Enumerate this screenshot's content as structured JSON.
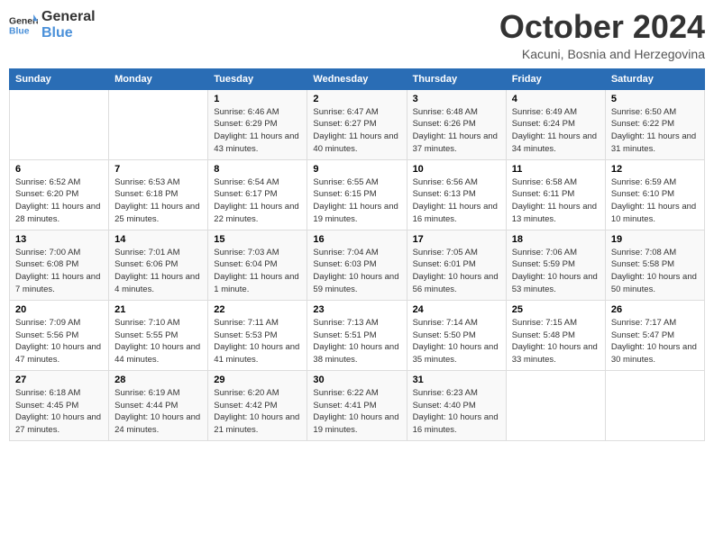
{
  "header": {
    "logo_general": "General",
    "logo_blue": "Blue",
    "month": "October 2024",
    "location": "Kacuni, Bosnia and Herzegovina"
  },
  "weekdays": [
    "Sunday",
    "Monday",
    "Tuesday",
    "Wednesday",
    "Thursday",
    "Friday",
    "Saturday"
  ],
  "weeks": [
    [
      {
        "day": "",
        "info": ""
      },
      {
        "day": "",
        "info": ""
      },
      {
        "day": "1",
        "info": "Sunrise: 6:46 AM\nSunset: 6:29 PM\nDaylight: 11 hours and 43 minutes."
      },
      {
        "day": "2",
        "info": "Sunrise: 6:47 AM\nSunset: 6:27 PM\nDaylight: 11 hours and 40 minutes."
      },
      {
        "day": "3",
        "info": "Sunrise: 6:48 AM\nSunset: 6:26 PM\nDaylight: 11 hours and 37 minutes."
      },
      {
        "day": "4",
        "info": "Sunrise: 6:49 AM\nSunset: 6:24 PM\nDaylight: 11 hours and 34 minutes."
      },
      {
        "day": "5",
        "info": "Sunrise: 6:50 AM\nSunset: 6:22 PM\nDaylight: 11 hours and 31 minutes."
      }
    ],
    [
      {
        "day": "6",
        "info": "Sunrise: 6:52 AM\nSunset: 6:20 PM\nDaylight: 11 hours and 28 minutes."
      },
      {
        "day": "7",
        "info": "Sunrise: 6:53 AM\nSunset: 6:18 PM\nDaylight: 11 hours and 25 minutes."
      },
      {
        "day": "8",
        "info": "Sunrise: 6:54 AM\nSunset: 6:17 PM\nDaylight: 11 hours and 22 minutes."
      },
      {
        "day": "9",
        "info": "Sunrise: 6:55 AM\nSunset: 6:15 PM\nDaylight: 11 hours and 19 minutes."
      },
      {
        "day": "10",
        "info": "Sunrise: 6:56 AM\nSunset: 6:13 PM\nDaylight: 11 hours and 16 minutes."
      },
      {
        "day": "11",
        "info": "Sunrise: 6:58 AM\nSunset: 6:11 PM\nDaylight: 11 hours and 13 minutes."
      },
      {
        "day": "12",
        "info": "Sunrise: 6:59 AM\nSunset: 6:10 PM\nDaylight: 11 hours and 10 minutes."
      }
    ],
    [
      {
        "day": "13",
        "info": "Sunrise: 7:00 AM\nSunset: 6:08 PM\nDaylight: 11 hours and 7 minutes."
      },
      {
        "day": "14",
        "info": "Sunrise: 7:01 AM\nSunset: 6:06 PM\nDaylight: 11 hours and 4 minutes."
      },
      {
        "day": "15",
        "info": "Sunrise: 7:03 AM\nSunset: 6:04 PM\nDaylight: 11 hours and 1 minute."
      },
      {
        "day": "16",
        "info": "Sunrise: 7:04 AM\nSunset: 6:03 PM\nDaylight: 10 hours and 59 minutes."
      },
      {
        "day": "17",
        "info": "Sunrise: 7:05 AM\nSunset: 6:01 PM\nDaylight: 10 hours and 56 minutes."
      },
      {
        "day": "18",
        "info": "Sunrise: 7:06 AM\nSunset: 5:59 PM\nDaylight: 10 hours and 53 minutes."
      },
      {
        "day": "19",
        "info": "Sunrise: 7:08 AM\nSunset: 5:58 PM\nDaylight: 10 hours and 50 minutes."
      }
    ],
    [
      {
        "day": "20",
        "info": "Sunrise: 7:09 AM\nSunset: 5:56 PM\nDaylight: 10 hours and 47 minutes."
      },
      {
        "day": "21",
        "info": "Sunrise: 7:10 AM\nSunset: 5:55 PM\nDaylight: 10 hours and 44 minutes."
      },
      {
        "day": "22",
        "info": "Sunrise: 7:11 AM\nSunset: 5:53 PM\nDaylight: 10 hours and 41 minutes."
      },
      {
        "day": "23",
        "info": "Sunrise: 7:13 AM\nSunset: 5:51 PM\nDaylight: 10 hours and 38 minutes."
      },
      {
        "day": "24",
        "info": "Sunrise: 7:14 AM\nSunset: 5:50 PM\nDaylight: 10 hours and 35 minutes."
      },
      {
        "day": "25",
        "info": "Sunrise: 7:15 AM\nSunset: 5:48 PM\nDaylight: 10 hours and 33 minutes."
      },
      {
        "day": "26",
        "info": "Sunrise: 7:17 AM\nSunset: 5:47 PM\nDaylight: 10 hours and 30 minutes."
      }
    ],
    [
      {
        "day": "27",
        "info": "Sunrise: 6:18 AM\nSunset: 4:45 PM\nDaylight: 10 hours and 27 minutes."
      },
      {
        "day": "28",
        "info": "Sunrise: 6:19 AM\nSunset: 4:44 PM\nDaylight: 10 hours and 24 minutes."
      },
      {
        "day": "29",
        "info": "Sunrise: 6:20 AM\nSunset: 4:42 PM\nDaylight: 10 hours and 21 minutes."
      },
      {
        "day": "30",
        "info": "Sunrise: 6:22 AM\nSunset: 4:41 PM\nDaylight: 10 hours and 19 minutes."
      },
      {
        "day": "31",
        "info": "Sunrise: 6:23 AM\nSunset: 4:40 PM\nDaylight: 10 hours and 16 minutes."
      },
      {
        "day": "",
        "info": ""
      },
      {
        "day": "",
        "info": ""
      }
    ]
  ]
}
